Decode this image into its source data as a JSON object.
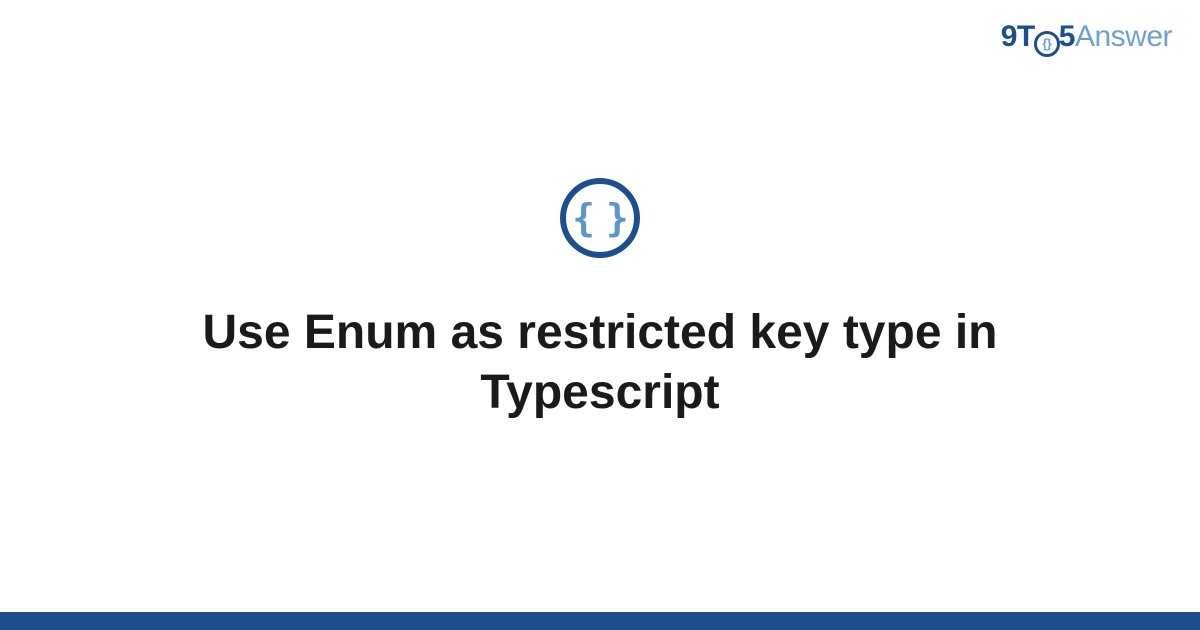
{
  "brand": {
    "part1": "9T",
    "circle_inner": "{}",
    "part2": "5",
    "part3": "Answer"
  },
  "category_icon": {
    "name": "code-braces-icon",
    "glyph": "{ }"
  },
  "title": "Use Enum as restricted key type in Typescript",
  "colors": {
    "primary": "#1d4f8c",
    "accent": "#6ea0d6"
  }
}
